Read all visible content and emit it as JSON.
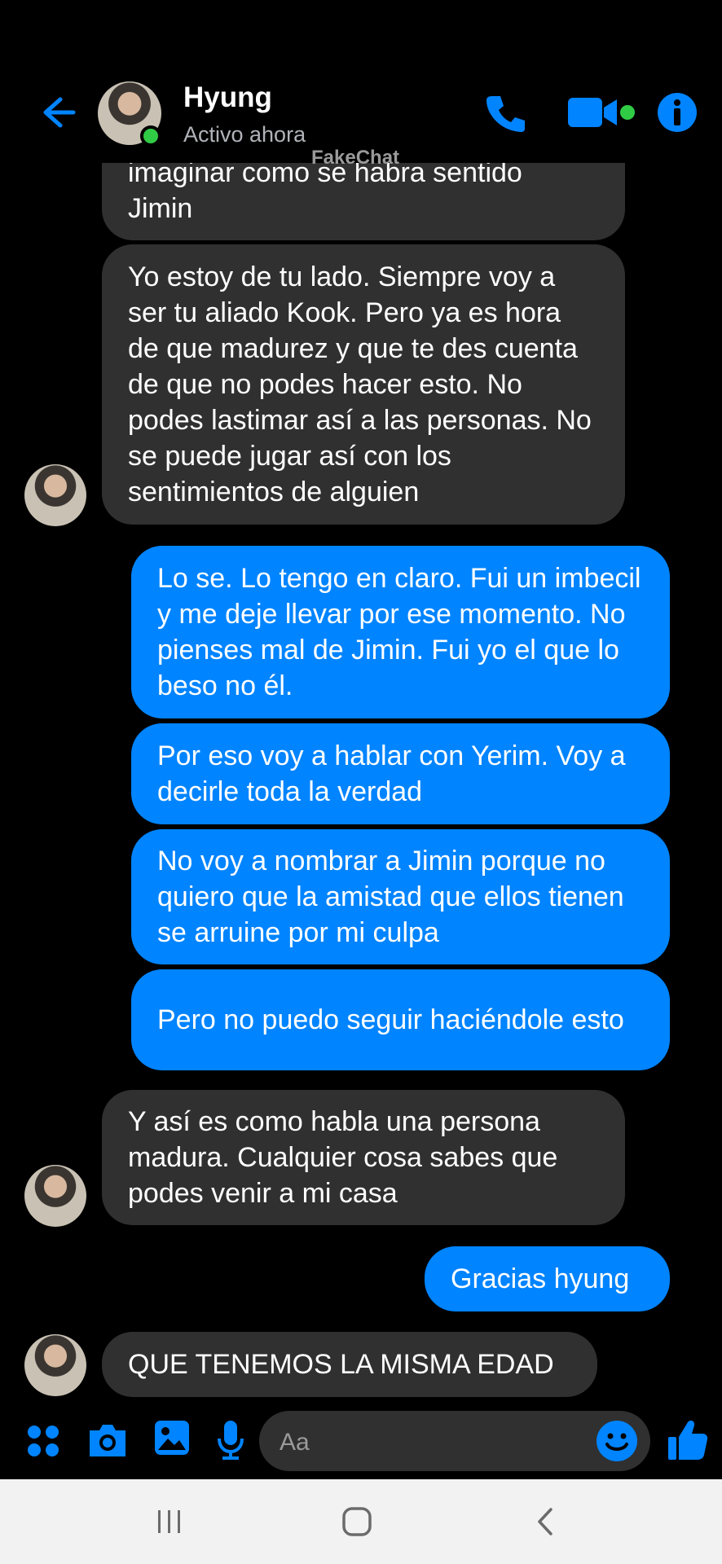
{
  "header": {
    "contact_name": "Hyung",
    "status": "Activo ahora",
    "watermark": "FakeChat",
    "icons": [
      "back-arrow-icon",
      "phone-icon",
      "video-camera-icon",
      "info-icon"
    ]
  },
  "messages": [
    {
      "side": "in",
      "text_lines": [
        "imaginar como se habra sentido",
        "Jimin"
      ]
    },
    {
      "side": "in",
      "text": "Yo estoy de tu lado. Siempre voy a ser tu aliado Kook. Pero ya es hora de que madurez y que te des cuenta de que no podes hacer esto. No podes lastimar así a las personas. No se puede jugar así con los sentimientos de alguien"
    },
    {
      "side": "out",
      "text": "Lo se. Lo tengo en claro. Fui un imbecil y me deje llevar por ese momento. No pienses mal de Jimin. Fui yo el que lo beso no él."
    },
    {
      "side": "out",
      "text": "Por eso voy a hablar con Yerim. Voy a decirle toda la verdad"
    },
    {
      "side": "out",
      "text": "No voy a nombrar a Jimin porque no quiero que la amistad que ellos tienen se arruine por mi culpa"
    },
    {
      "side": "out",
      "text": "Pero no puedo seguir haciéndole esto"
    },
    {
      "side": "in",
      "text": "Y así es como habla una persona madura. Cualquier cosa sabes que podes venir a mi casa"
    },
    {
      "side": "out",
      "text": "Gracias hyung"
    },
    {
      "side": "in",
      "text": "QUE TENEMOS LA MISMA EDAD"
    }
  ],
  "composer": {
    "placeholder": "Aa",
    "icons": [
      "apps-grid-icon",
      "camera-icon",
      "gallery-icon",
      "microphone-icon",
      "emoji-icon",
      "thumbs-up-icon"
    ]
  },
  "colors": {
    "accent": "#0084ff",
    "incoming_bubble": "#303030",
    "background": "#000000",
    "online": "#31cc46"
  }
}
